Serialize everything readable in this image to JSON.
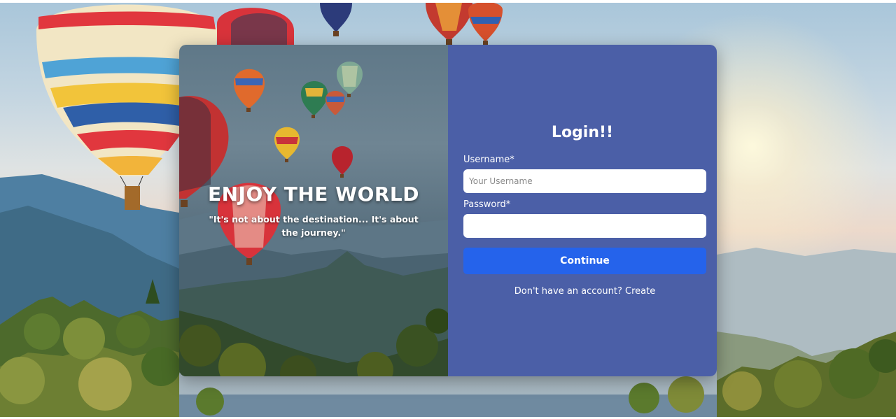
{
  "hero": {
    "heading": "ENJOY THE WORLD",
    "quote": "\"It's not about the destination... It's about the journey.\""
  },
  "login": {
    "title": "Login!!",
    "username_label": "Username*",
    "username_placeholder": "Your Username",
    "username_value": "",
    "password_label": "Password*",
    "password_value": "",
    "continue_label": "Continue",
    "signup_prompt": "Don't have an account?",
    "signup_link": "Create"
  },
  "colors": {
    "panel": "#4b5fa7",
    "button": "#2563eb"
  },
  "icons": [
    "hot-air-balloon-icon",
    "mountain-icon",
    "tree-icon"
  ]
}
